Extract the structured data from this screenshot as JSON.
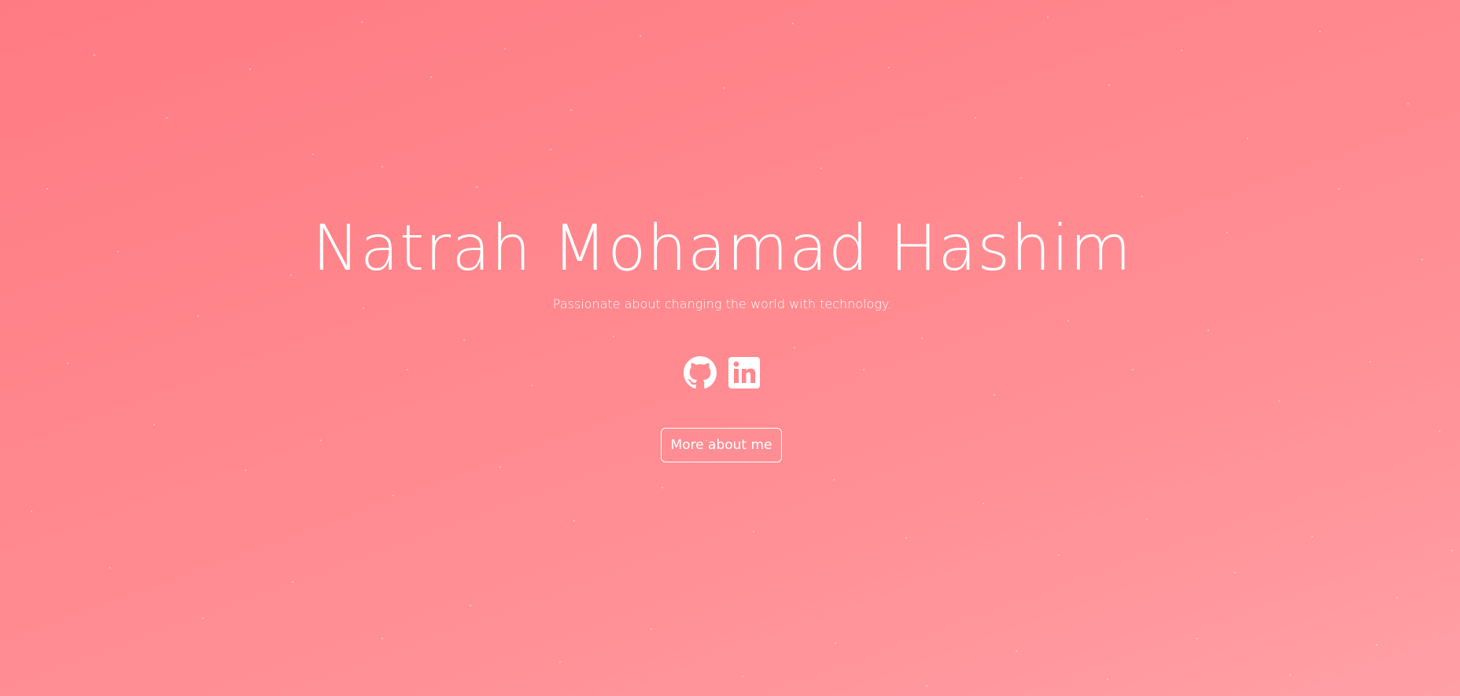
{
  "hero": {
    "name": "Natrah Mohamad Hashim",
    "tagline": "Passionate about changing the world with technology.",
    "socials": [
      {
        "icon": "github-icon"
      },
      {
        "icon": "linkedin-icon"
      }
    ],
    "cta_label": "More about me"
  },
  "colors": {
    "background_start": "#ff7b83",
    "background_end": "#ffa0a6",
    "text": "#ffffff"
  }
}
